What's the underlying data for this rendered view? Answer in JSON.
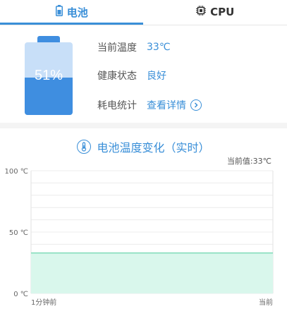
{
  "tabs": [
    {
      "label": "电池",
      "active": true,
      "icon": "battery-icon"
    },
    {
      "label": "CPU",
      "active": false,
      "icon": "cpu-chip-icon"
    }
  ],
  "battery": {
    "percent_label": "51%",
    "level": 0.51,
    "fill_color": "#3f8ee0",
    "empty_color": "#c8dff8"
  },
  "info": {
    "temp_label": "当前温度",
    "temp_value": "33℃",
    "health_label": "健康状态",
    "health_value": "良好",
    "stats_label": "耗电统计",
    "stats_link": "查看详情"
  },
  "chart_section": {
    "title": "电池温度变化（实时）",
    "current_value": "当前值:33℃"
  },
  "chart_data": {
    "type": "area",
    "x_labels": [
      "1分钟前",
      "当前"
    ],
    "y_ticks": [
      "0 ℃",
      "50 ℃",
      "100 ℃"
    ],
    "ylim": [
      0,
      100
    ],
    "series": [
      {
        "values": [
          33,
          33
        ]
      }
    ],
    "grid": true,
    "fill_color": "#d9f7ec",
    "line_color": "#7edbb8"
  },
  "colors": {
    "accent": "#3a8fd8"
  }
}
